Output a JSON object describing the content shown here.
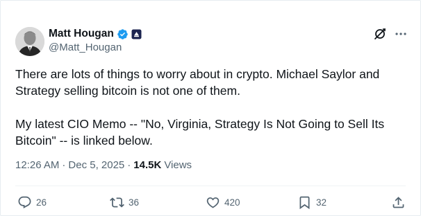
{
  "author": {
    "name": "Matt Hougan",
    "handle": "@Matt_Hougan"
  },
  "tweet": {
    "text": "There are lots of things to worry about in crypto. Michael Saylor and\nStrategy selling bitcoin is not one of them.\n\nMy latest CIO Memo -- \"No, Virginia, Strategy Is Not Going to Sell Its\nBitcoin\" -- is linked below."
  },
  "meta": {
    "time": "12:26 AM",
    "separator": "·",
    "date": "Dec 5, 2025",
    "views_count": "14.5K",
    "views_label": "Views"
  },
  "actions": {
    "replies": "26",
    "reposts": "36",
    "likes": "420",
    "bookmarks": "32"
  },
  "icons": {
    "verified": "verified-badge-icon",
    "affiliation": "affiliation-badge-icon",
    "grok": "grok-icon",
    "more": "more-icon",
    "reply": "reply-icon",
    "repost": "repost-icon",
    "like": "heart-icon",
    "bookmark": "bookmark-icon",
    "share": "share-icon"
  },
  "colors": {
    "verified_blue": "#1d9bf0",
    "text_primary": "#0f1419",
    "text_secondary": "#536471",
    "divider": "#eff3f4"
  }
}
